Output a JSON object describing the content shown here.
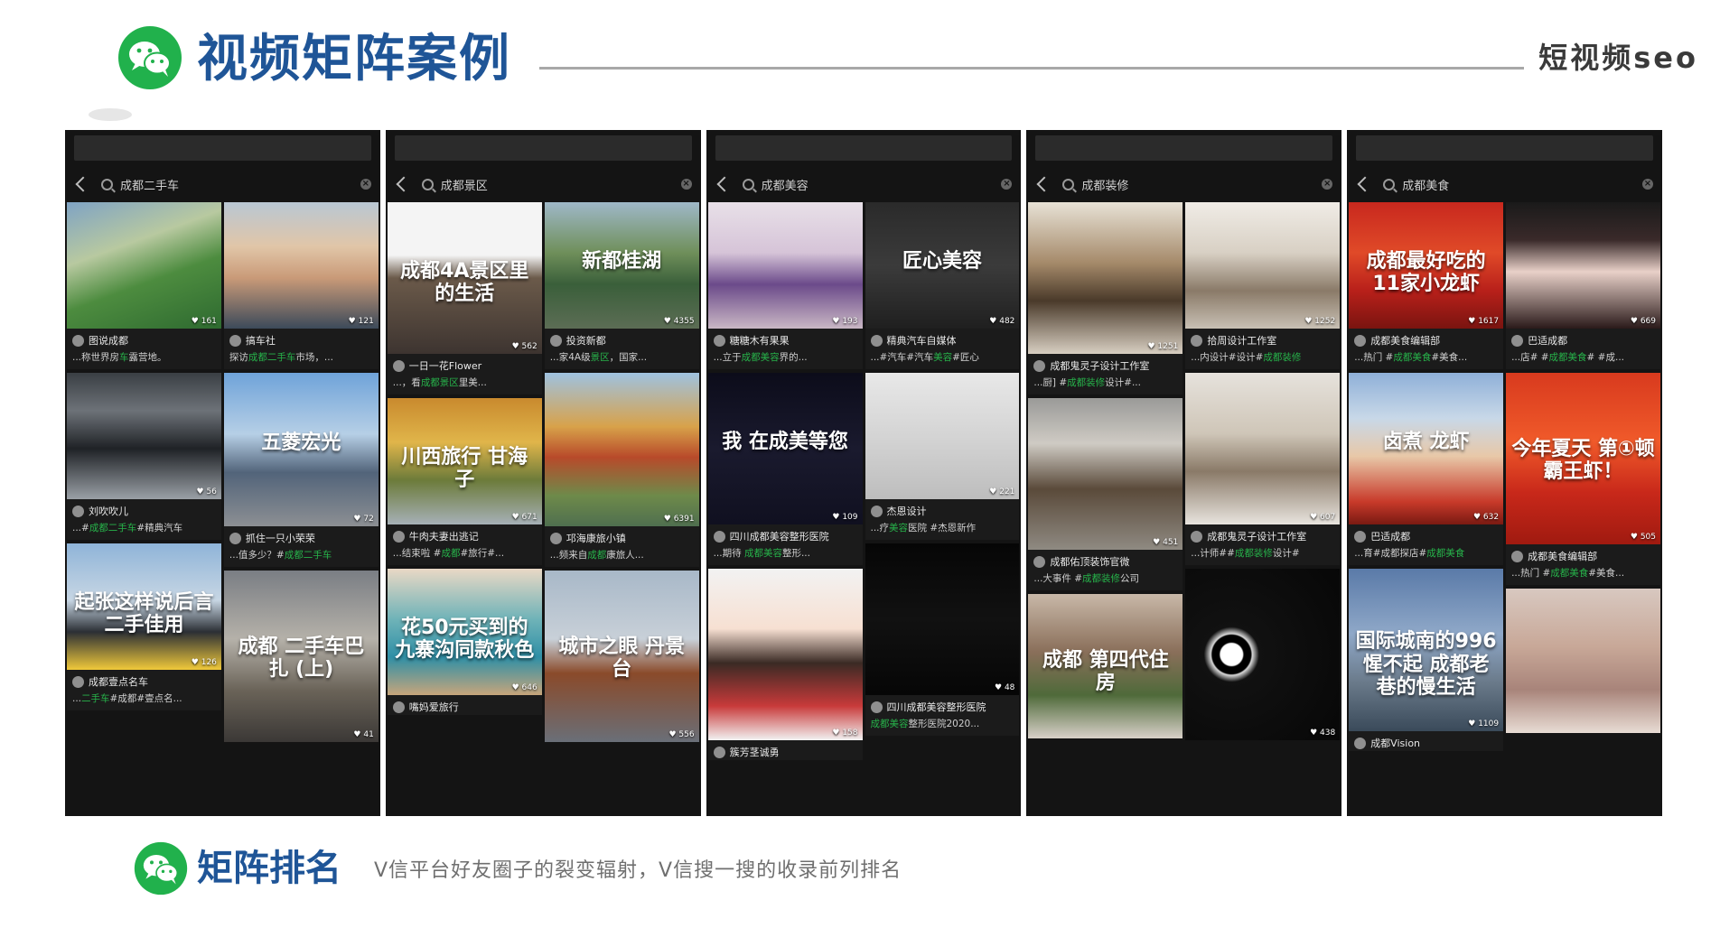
{
  "header": {
    "title": "视频矩阵案例",
    "right_label": "短视频seo"
  },
  "footer": {
    "title": "矩阵排名",
    "subtitle": "V信平台好友圈子的裂变辐射，V信搜一搜的收录前列排名"
  },
  "colors": {
    "accent": "#1f5597",
    "keyword": "#27b24a",
    "logo_green": "#21b14c"
  },
  "phones": [
    {
      "query": "成都二手车",
      "columns": [
        [
          {
            "likes": "161",
            "author": "图说成都",
            "pre": "...称世界房",
            "kw": "车",
            "post": "露营地。",
            "overlay": "",
            "h": 140,
            "bg": "linear-gradient(160deg,#7fa3c4 0%,#b8c9a0 35%,#4d8c3f 60%,#2e6a30 100%)"
          },
          {
            "likes": "56",
            "author": "刘吹吹儿",
            "pre": "...#",
            "kw": "成都二手车",
            "post": "#精典汽车",
            "overlay": "",
            "h": 140,
            "bg": "linear-gradient(180deg,#3a3f44 0%,#6d7278 30%,#1f2226 60%,#9aa0a6 100%)"
          },
          {
            "likes": "126",
            "author": "成都壹点名车",
            "pre": "...",
            "kw": "二手车",
            "post": "#成都#壹点名...",
            "overlay": "起张这样说后言二手佳用",
            "h": 140,
            "bg": "linear-gradient(180deg,#8fb4d8 0%,#c7d6e4 45%,#2b2f35 70%,#f0c93a 100%)"
          }
        ],
        [
          {
            "likes": "121",
            "author": "搞车社",
            "pre": "探访",
            "kw": "成都二手车",
            "post": "市场，...",
            "overlay": "",
            "h": 140,
            "bg": "linear-gradient(180deg,#b9c7d3 0%,#e1c6a8 35%,#c99a78 60%,#3c4a5a 100%)"
          },
          {
            "likes": "72",
            "author": "抓住一只小荣荣",
            "pre": "...值多少？#",
            "kw": "成都二手车",
            "post": "",
            "overlay": "五菱宏光",
            "h": 170,
            "bg": "linear-gradient(180deg,#6fa3d9 0%,#b6cfe6 40%,#52647a 65%,#8c8f93 100%)"
          },
          {
            "likes": "41",
            "author": "",
            "pre": "",
            "kw": "",
            "post": "",
            "overlay": "成都 二手车巴扎 (上)",
            "h": 190,
            "bg": "linear-gradient(180deg,#7a7e84 0%,#b5b1a9 40%,#6a6358 70%,#3b3836 100%)"
          }
        ]
      ]
    },
    {
      "query": "成都景区",
      "columns": [
        [
          {
            "likes": "562",
            "author": "一日一花Flower",
            "pre": "...，看",
            "kw": "成都景区",
            "post": "里美...",
            "overlay": "成都4A景区里的生活",
            "h": 168,
            "bg": "linear-gradient(180deg,#f4f4f4 0%,#f4f4f4 35%,#6b5a4a 50%,#3d3430 100%)"
          },
          {
            "likes": "671",
            "author": "牛肉夫妻出逃记",
            "pre": "...结束啦 #",
            "kw": "成都",
            "post": "#旅行#...",
            "overlay": "川西旅行 甘海子",
            "h": 140,
            "bg": "linear-gradient(180deg,#c98a2e 0%,#e0b54a 35%,#6c7b3a 65%,#a6b0b7 100%)"
          },
          {
            "likes": "646",
            "author": "嘴妈爱旅行",
            "pre": "",
            "kw": "",
            "post": "",
            "overlay": "花50元买到的 九寨沟同款秋色",
            "h": 140,
            "bg": "linear-gradient(180deg,#e9d8c5 0%,#6fb3b8 40%,#2f8fa6 70%,#c7a57b 100%)"
          }
        ],
        [
          {
            "likes": "4355",
            "author": "投资新都",
            "pre": "...家4A级",
            "kw": "景区",
            "post": "，国家...",
            "overlay": "新都桂湖",
            "h": 140,
            "bg": "linear-gradient(180deg,#9fb8c8 0%,#6f8f5a 40%,#3a5f3a 65%,#5c6d55 100%)"
          },
          {
            "likes": "6391",
            "author": "邛海康旅小镇",
            "pre": "...频来自",
            "kw": "成都",
            "post": "康旅人...",
            "overlay": "",
            "h": 170,
            "bg": "linear-gradient(180deg,#9fc2e0 0%,#d8a24a 35%,#b84a2a 55%,#6e8a4a 80%,#4f6f4f 100%)"
          },
          {
            "likes": "556",
            "author": "",
            "pre": "",
            "kw": "",
            "post": "",
            "overlay": "城市之眼 丹景台",
            "h": 190,
            "bg": "linear-gradient(180deg,#a8b8c8 0%,#c8d0d8 40%,#8a4a2a 60%,#6a6f78 100%)"
          }
        ]
      ]
    },
    {
      "query": "成都美容",
      "columns": [
        [
          {
            "likes": "193",
            "author": "糖糖木有果果",
            "pre": "...立于",
            "kw": "成都美容",
            "post": "界的...",
            "overlay": "",
            "h": 140,
            "bg": "linear-gradient(180deg,#e8e0e8 0%,#d6c4d8 40%,#6b4a8a 65%,#c9b7c4 100%)"
          },
          {
            "likes": "109",
            "author": "四川成都美容整形医院",
            "pre": "...期待 ",
            "kw": "成都美容",
            "post": "整形...",
            "overlay": "我 在成美等您",
            "h": 168,
            "bg": "linear-gradient(180deg,#0c0c1a 0%,#1a1a2e 50%,#101020 100%)"
          },
          {
            "likes": "158",
            "author": "簇芳茎诚勇",
            "pre": "",
            "kw": "",
            "post": "",
            "overlay": "",
            "h": 190,
            "bg": "linear-gradient(180deg,#f2f2f2 0%,#f7e0d2 35%,#3a2a24 55%,#c83a3a 80%,#f2f2f2 100%)"
          }
        ],
        [
          {
            "likes": "482",
            "author": "精典汽车自媒体",
            "pre": "...#汽车#汽车",
            "kw": "美容",
            "post": "#匠心",
            "overlay": "匠心美容",
            "h": 140,
            "bg": "linear-gradient(180deg,#2a2a2a 0%,#3b3b3b 50%,#1f1f1f 100%)"
          },
          {
            "likes": "221",
            "author": "杰恩设计",
            "pre": "...疗",
            "kw": "美容",
            "post": "医院 #杰恩新作",
            "overlay": "",
            "h": 140,
            "bg": "linear-gradient(180deg,#e8e8e8 0%,#d4d4d4 50%,#bdbdbd 100%)"
          },
          {
            "likes": "48",
            "author": "四川成都美容整形医院",
            "pre": "",
            "kw": "成都美容",
            "post": "整形医院2020...",
            "overlay": "",
            "h": 168,
            "bg": "linear-gradient(180deg,#060606 0%,#111 50%,#060606 100%)"
          }
        ]
      ]
    },
    {
      "query": "成都装修",
      "columns": [
        [
          {
            "likes": "1251",
            "author": "成都鬼灵子设计工作室",
            "pre": "...厨] #",
            "kw": "成都装修",
            "post": "设计#...",
            "overlay": "",
            "h": 168,
            "bg": "linear-gradient(180deg,#e8e2d6 0%,#a58a6a 40%,#4a3a2a 65%,#d8cfc2 100%)"
          },
          {
            "likes": "451",
            "author": "成都佑顶装饰官微",
            "pre": "...大事件 #",
            "kw": "成都装修",
            "post": "公司",
            "overlay": "",
            "h": 168,
            "bg": "linear-gradient(180deg,#9a9a98 0%,#cfcbc4 30%,#5a4a3a 60%,#8f8a82 100%)"
          },
          {
            "likes": "",
            "author": "",
            "pre": "",
            "kw": "",
            "post": "",
            "overlay": "成都 第四代住房",
            "h": 160,
            "bg": "linear-gradient(180deg,#c8b8a8 0%,#8a6f5a 40%,#4f6a3a 70%,#d8d0c8 100%)"
          }
        ],
        [
          {
            "likes": "1252",
            "author": "拾周设计工作室",
            "pre": "...内设计#设计#",
            "kw": "成都装修",
            "post": "",
            "overlay": "",
            "h": 140,
            "bg": "linear-gradient(180deg,#f0ece6 0%,#d8d0c4 40%,#8a7a68 70%,#c8c0b4 100%)"
          },
          {
            "likes": "607",
            "author": "成都鬼灵子设计工作室",
            "pre": "...计师##",
            "kw": "成都装修",
            "post": "设计#",
            "overlay": "",
            "h": 168,
            "bg": "linear-gradient(180deg,#e6e2dc 0%,#cfc6b8 40%,#8a7a68 65%,#e8e4de 100%)"
          },
          {
            "likes": "438",
            "author": "",
            "pre": "",
            "kw": "",
            "post": "",
            "overlay": "",
            "h": 190,
            "bg": "radial-gradient(circle at 30% 50%,#ffffff 0%,#ffffff 8%,#000 9%,#000 14%,#d8d8d8 15%,#111 20%,#070707 100%)"
          }
        ]
      ]
    },
    {
      "query": "成都美食",
      "columns": [
        [
          {
            "likes": "1617",
            "author": "成都美食编辑部",
            "pre": "...热门 #",
            "kw": "成都美食",
            "post": "#美食...",
            "overlay": "成都最好吃的 11家小龙虾",
            "h": 140,
            "bg": "linear-gradient(180deg,#c8281e 0%,#e04a28 40%,#b8201a 70%,#7a1410 100%)"
          },
          {
            "likes": "632",
            "author": "巴适成都",
            "pre": "...育#成都探店#",
            "kw": "成都美食",
            "post": "",
            "overlay": "卤煮 龙虾",
            "h": 168,
            "bg": "linear-gradient(180deg,#8fb0d8 0%,#c8d8e8 30%,#e8c8a8 55%,#c83a2a 85%,#7a1a12 100%)"
          },
          {
            "likes": "1109",
            "author": "成都Vision",
            "pre": "",
            "kw": "",
            "post": "",
            "overlay": "国际城南的996 惺不起 成都老巷的慢生活",
            "h": 180,
            "bg": "linear-gradient(180deg,#5a7aa8 0%,#8fa8c8 40%,#6a7a8a 70%,#3a4a5a 100%)"
          }
        ],
        [
          {
            "likes": "669",
            "author": "巴适成都",
            "pre": "...店# #",
            "kw": "成都美食",
            "post": "# #成...",
            "overlay": "",
            "h": 140,
            "bg": "linear-gradient(180deg,#1a1a1a 0%,#3a2a2a 30%,#e8d0c8 55%,#2a1a1a 100%)"
          },
          {
            "likes": "505",
            "author": "成都美食编辑部",
            "pre": "...热门 #",
            "kw": "成都美食",
            "post": "#美食...",
            "overlay": "今年夏天 第①顿霸王虾！",
            "h": 190,
            "bg": "linear-gradient(180deg,#d83a1e 0%,#f05a2a 40%,#c8281a 70%,#a01a10 100%)"
          },
          {
            "likes": "",
            "author": "",
            "pre": "",
            "kw": "",
            "post": "",
            "overlay": "",
            "h": 160,
            "bg": "linear-gradient(180deg,#d8c8c0 0%,#c8a898 40%,#a8847a 70%,#e8dcd4 100%)"
          }
        ]
      ]
    }
  ]
}
